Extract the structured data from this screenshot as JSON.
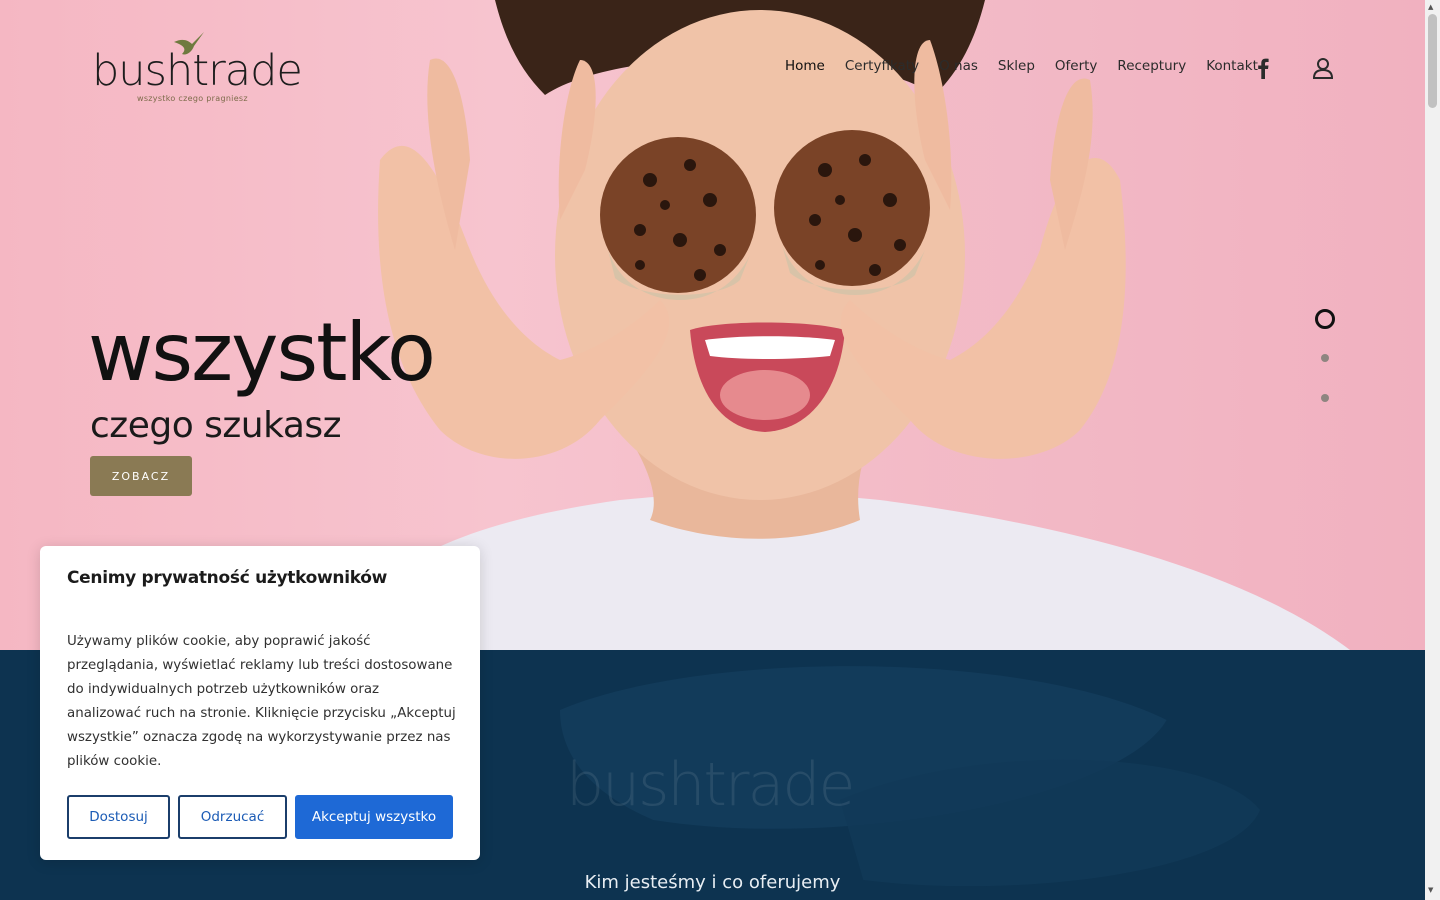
{
  "brand": {
    "logo_main": "bush",
    "logo_trade": "trade",
    "logo_tagline": "wszystko czego pragniesz",
    "accent": "#8a7a54"
  },
  "nav": {
    "items": [
      {
        "label": "Home"
      },
      {
        "label": "Certyfikaty"
      },
      {
        "label": "O nas"
      },
      {
        "label": "Sklep"
      },
      {
        "label": "Oferty"
      },
      {
        "label": "Receptury"
      },
      {
        "label": "Kontakt"
      }
    ]
  },
  "icons": {
    "facebook": "facebook-icon",
    "account": "user-icon"
  },
  "hero": {
    "title": "wszystko",
    "subtitle": "czego szukasz",
    "button": "ZOBACZ",
    "slides_total": 3,
    "active_slide": 1
  },
  "section": {
    "logo_main": "bush",
    "logo_trade": "trade",
    "heading": "Kim jesteśmy i co oferujemy",
    "background": "#0d3350"
  },
  "cookie": {
    "title": "Cenimy prywatność użytkowników",
    "text": "Używamy plików cookie, aby poprawić jakość przeglądania, wyświetlać reklamy lub treści dostosowane do indywidualnych potrzeb użytkowników oraz analizować ruch na stronie. Kliknięcie przycisku „Akceptuj wszystkie” oznacza zgodę na wykorzystywanie przez nas plików cookie.",
    "btn_customize": "Dostosuj",
    "btn_reject": "Odrzucać",
    "btn_accept": "Akceptuj wszystko",
    "accept_color": "#1e69d6"
  }
}
